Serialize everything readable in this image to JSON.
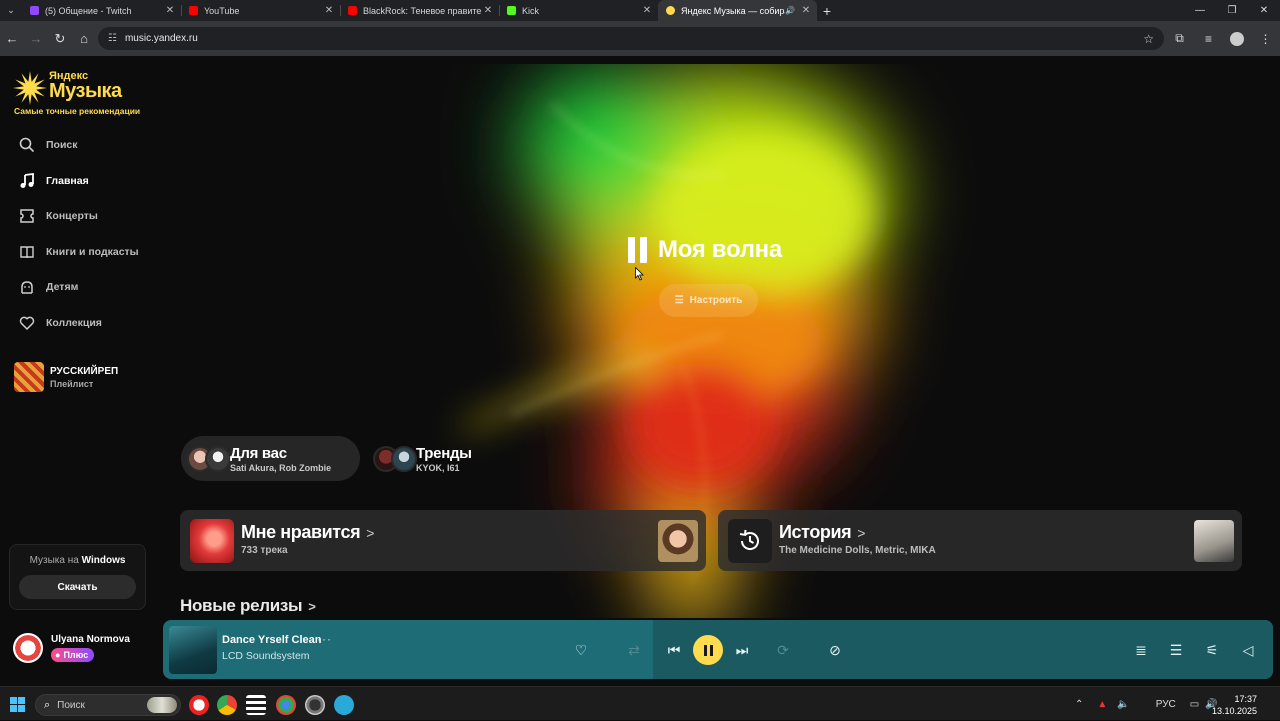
{
  "browser": {
    "tabs": [
      {
        "title": "(5) Общение - Twitch",
        "favicon_color": "#9146ff",
        "active": false
      },
      {
        "title": "YouTube",
        "favicon_color": "#ff0000",
        "active": false
      },
      {
        "title": "BlackRock: Теневое правитель",
        "favicon_color": "#ff0000",
        "active": false
      },
      {
        "title": "Kick",
        "favicon_color": "#53fc18",
        "active": false
      },
      {
        "title": "Яндекс Музыка — собира",
        "favicon_color": "#ffdb4d",
        "active": true
      }
    ],
    "url": "music.yandex.ru"
  },
  "sidebar": {
    "logo": {
      "line1": "Яндекс",
      "line2": "Музыка",
      "tagline": "Самые точные рекомендации"
    },
    "nav": [
      {
        "label": "Поиск",
        "icon": "search-icon",
        "active": false
      },
      {
        "label": "Главная",
        "icon": "music-note-icon",
        "active": true
      },
      {
        "label": "Концерты",
        "icon": "ticket-icon",
        "active": false
      },
      {
        "label": "Книги и подкасты",
        "icon": "book-icon",
        "active": false
      },
      {
        "label": "Детям",
        "icon": "kids-icon",
        "active": false
      },
      {
        "label": "Коллекция",
        "icon": "heart-icon",
        "active": false
      }
    ],
    "playlist": {
      "title": "РУССКИЙРЕП",
      "subtitle": "Плейлист"
    },
    "download": {
      "caption_pre": "Музыка на ",
      "caption_bold": "Windows",
      "button": "Скачать"
    },
    "user": {
      "name": "Ulyana Normova",
      "badge": "Плюс"
    }
  },
  "hero": {
    "title": "Моя волна",
    "tune_button": "Настроить",
    "chips": [
      {
        "title": "Для вас",
        "subtitle": "Sati Akura, Rob Zombie"
      },
      {
        "title": "Тренды",
        "subtitle": "KYOK, I61"
      }
    ],
    "cards": [
      {
        "title": "Мне нравится",
        "subtitle": "733 трека"
      },
      {
        "title": "История",
        "subtitle": "The Medicine Dolls, Metric, MIKA"
      }
    ],
    "section_heading": "Новые релизы"
  },
  "player": {
    "track": "Dance Yrself Clean",
    "artist": "LCD Soundsystem",
    "state": "playing",
    "colors": {
      "bar": "#1e6c75",
      "play_button": "#ffdb4d"
    }
  },
  "taskbar": {
    "search_placeholder": "Поиск",
    "language": "РУС",
    "time": "17:37",
    "date": "13.10.2025"
  },
  "colors": {
    "brand": "#ffdb4d",
    "background": "#0c0c0c"
  }
}
